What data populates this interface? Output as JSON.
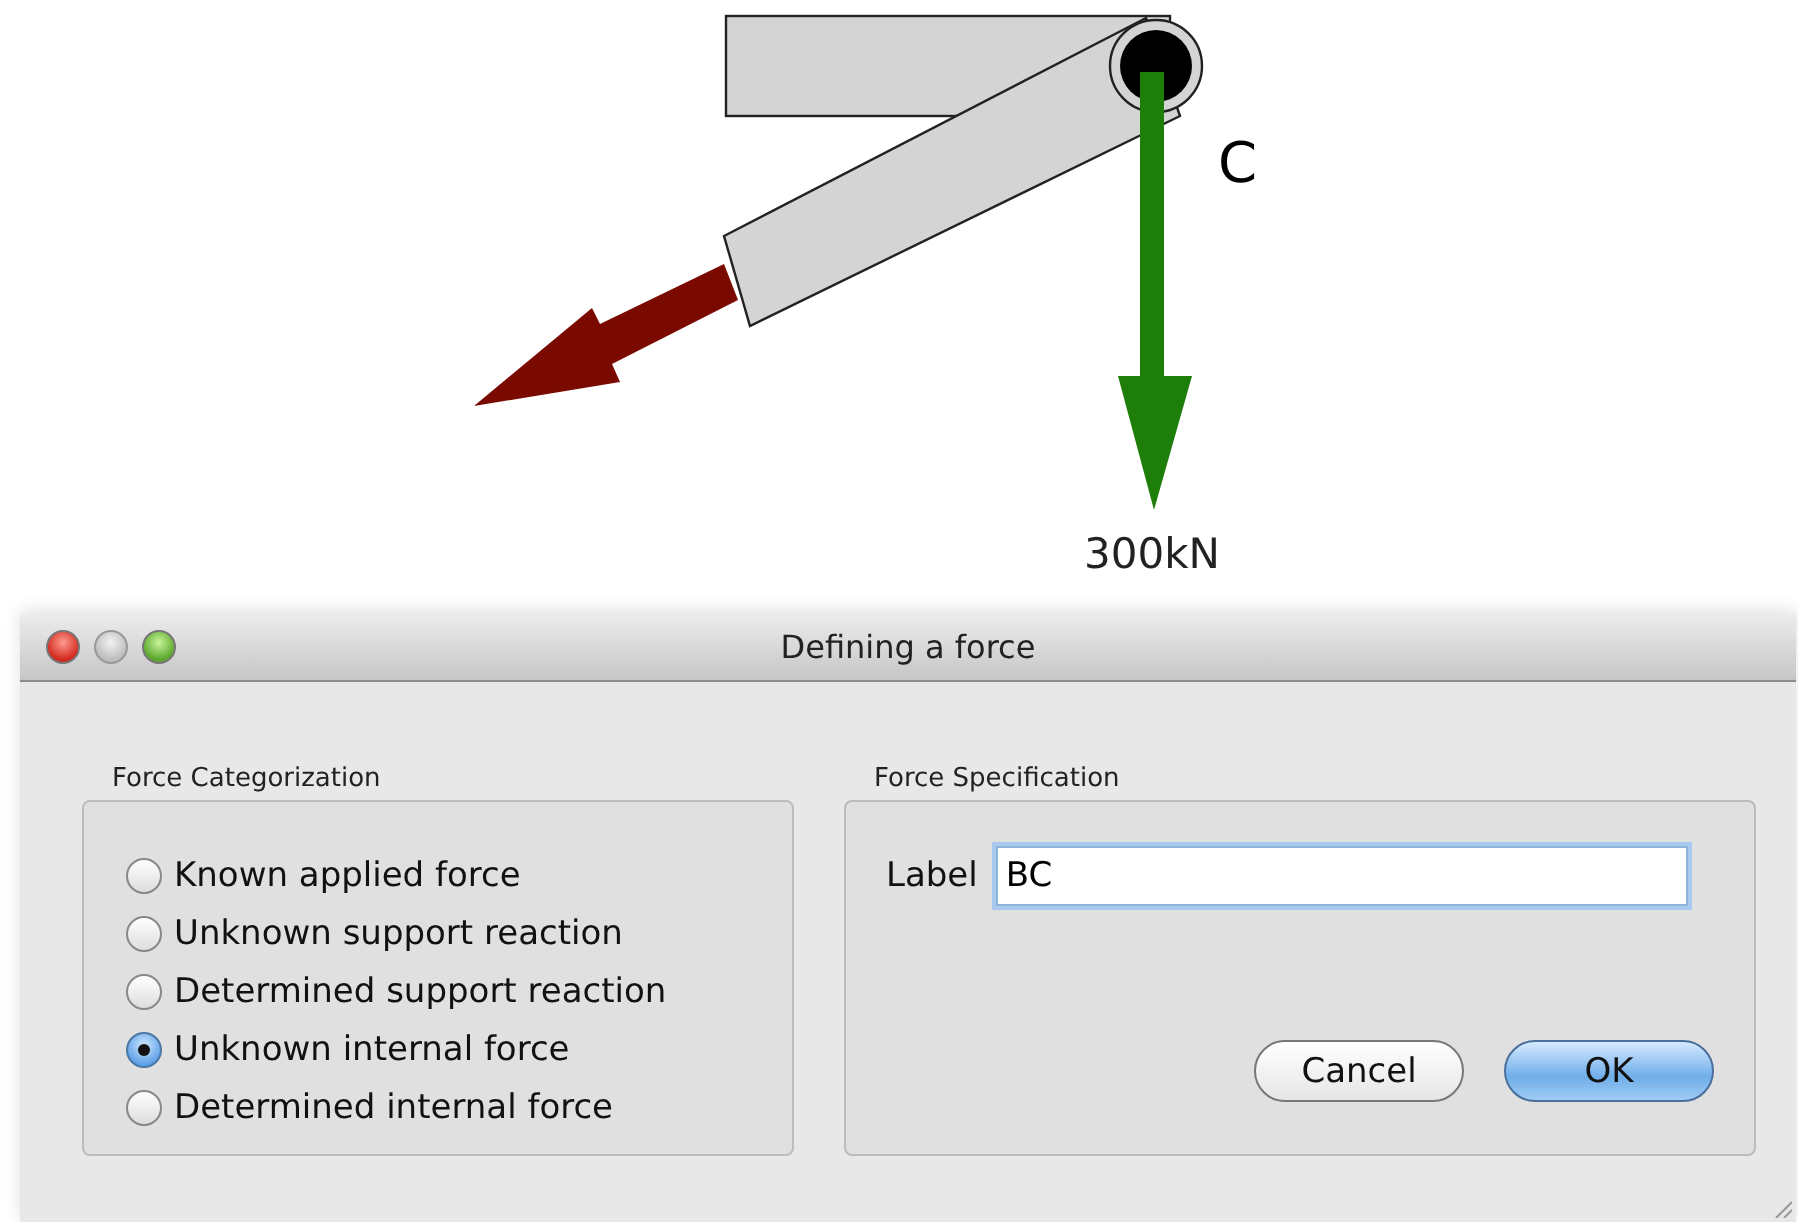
{
  "canvas": {
    "joint_label": "C",
    "force_label": "300kN"
  },
  "dialog": {
    "title": "Defining a force",
    "categorization": {
      "title": "Force Categorization",
      "options": [
        {
          "label": "Known applied force",
          "selected": false
        },
        {
          "label": "Unknown support reaction",
          "selected": false
        },
        {
          "label": "Determined support reaction",
          "selected": false
        },
        {
          "label": "Unknown internal force",
          "selected": true
        },
        {
          "label": "Determined internal force",
          "selected": false
        }
      ]
    },
    "specification": {
      "title": "Force Specification",
      "field_label": "Label",
      "value": "BC"
    },
    "buttons": [
      {
        "label": "Cancel",
        "kind": "normal"
      },
      {
        "label": "OK",
        "kind": "default"
      }
    ]
  }
}
